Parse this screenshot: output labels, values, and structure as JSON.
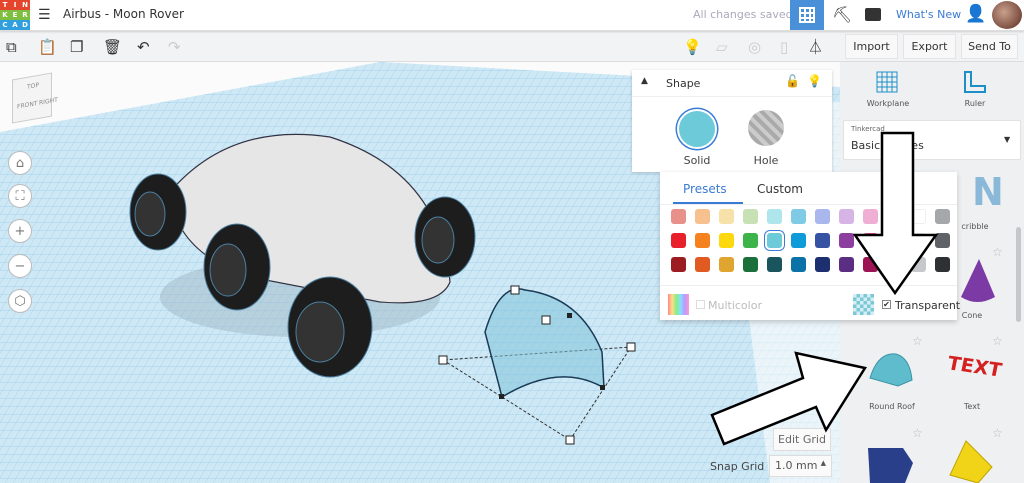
{
  "app": {
    "logo_letters": [
      "T",
      "I",
      "N",
      "K",
      "E",
      "R",
      "C",
      "A",
      "D"
    ],
    "logo_colors": [
      "#e3462d",
      "#e3462d",
      "#e3462d",
      "#7fbf3f",
      "#7fbf3f",
      "#7fbf3f",
      "#2f9fe0",
      "#2f9fe0",
      "#2f9fe0"
    ],
    "design_title": "Airbus - Moon Rover",
    "save_status": "All changes saved",
    "whats_new": "What's New"
  },
  "toolbar": {
    "import": "Import",
    "export": "Export",
    "send_to": "Send To"
  },
  "view_cube": {
    "top": "TOP",
    "front": "FRONT",
    "right": "RIGHT"
  },
  "shape_panel": {
    "title": "Shape",
    "solid": "Solid",
    "hole": "Hole"
  },
  "color_popup": {
    "tabs": [
      "Presets",
      "Custom"
    ],
    "active_tab": "Presets",
    "multicolor": "Multicolor",
    "transparent": "Transparent",
    "transparent_checked": true,
    "swatches": [
      [
        "#e8918a",
        "#f6c08f",
        "#f6e2a8",
        "#c7e1b5",
        "#aee6ec",
        "#7fcbe6",
        "#a9b7ed",
        "#d6b4e6",
        "#efaed4",
        "#f3f3f3",
        "#ffffff",
        "#a5a7aa"
      ],
      [
        "#e8202c",
        "#f5821f",
        "#fcd90f",
        "#3cb44a",
        "#6ccad9",
        "#0e9bd8",
        "#3552a3",
        "#8d3fa0",
        "#e84f9b",
        "#ffffff",
        "#ffffff",
        "#5f6368"
      ],
      [
        "#9b1c21",
        "#e05a22",
        "#e0a530",
        "#1a6f3a",
        "#1a545c",
        "#0a72a7",
        "#1c2f6e",
        "#5b2d83",
        "#9c1453",
        "#ffffff",
        "#c6c8cb",
        "#2e3033"
      ]
    ],
    "selected": "#6ccad9"
  },
  "library": {
    "workplane": "Workplane",
    "ruler": "Ruler",
    "dropdown_small": "Tinkercad",
    "dropdown_value": "Basic Shapes",
    "dropdown_visible": "Basic S",
    "shapes": [
      "cribble",
      "Cone",
      "Round Roof",
      "Text"
    ]
  },
  "grid": {
    "edit_grid": "Edit Grid",
    "snap_label": "Snap Grid",
    "snap_value": "1.0 mm"
  }
}
